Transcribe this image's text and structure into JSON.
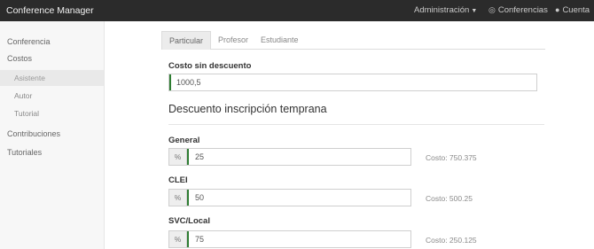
{
  "navbar": {
    "brand": "Conference Manager",
    "admin_label": "Administración",
    "conferencias_label": "Conferencias",
    "cuenta_label": "Cuenta"
  },
  "sidebar": {
    "items": {
      "conferencia": "Conferencia",
      "costos": "Costos",
      "asistente": "Asistente",
      "autor": "Autor",
      "tutorial": "Tutorial",
      "contribuciones": "Contribuciones",
      "tutoriales": "Tutoriales"
    },
    "active": "Asistente"
  },
  "tabs": [
    "Particular",
    "Profesor",
    "Estudiante"
  ],
  "active_tab": "Particular",
  "form": {
    "costo_label": "Costo sin descuento",
    "costo_value": "1000,5",
    "section_title": "Descuento inscripción temprana",
    "percent_symbol": "%",
    "groups": [
      {
        "label": "General",
        "percent": "25",
        "costo": "Costo: 750.375"
      },
      {
        "label": "CLEI",
        "percent": "50",
        "costo": "Costo: 500.25"
      },
      {
        "label": "SVC/Local",
        "percent": "75",
        "costo": "Costo: 250.125"
      }
    ]
  },
  "colors": {
    "navbar": "#2b2b2b",
    "accent_bar": "#2e7d32"
  },
  "icons": {
    "admin_caret": "caret-down-icon",
    "conferencias": "globe-icon",
    "cuenta": "user-icon"
  }
}
